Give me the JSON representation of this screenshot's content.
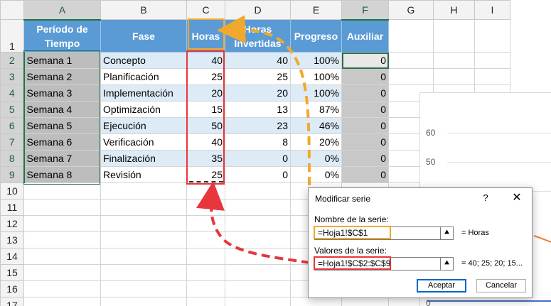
{
  "columns": [
    "A",
    "B",
    "C",
    "D",
    "E",
    "F",
    "G",
    "H",
    "I"
  ],
  "row_numbers": [
    "1",
    "2",
    "3",
    "4",
    "5",
    "6",
    "7",
    "8",
    "9",
    "10",
    "11",
    "12",
    "13",
    "14",
    "15",
    "16",
    "17"
  ],
  "headers": {
    "periodo": "Período de Tiempo",
    "fase": "Fase",
    "horas": "Horas",
    "invertidas": "Horas Invertidas",
    "progreso": "Progreso",
    "auxiliar": "Auxiliar"
  },
  "rows": [
    {
      "periodo": "Semana 1",
      "fase": "Concepto",
      "horas": "40",
      "invertidas": "40",
      "progreso": "100%",
      "auxiliar": "0"
    },
    {
      "periodo": "Semana 2",
      "fase": "Planificación",
      "horas": "25",
      "invertidas": "25",
      "progreso": "100%",
      "auxiliar": "0"
    },
    {
      "periodo": "Semana 3",
      "fase": "Implementación",
      "horas": "20",
      "invertidas": "20",
      "progreso": "100%",
      "auxiliar": "0"
    },
    {
      "periodo": "Semana 4",
      "fase": "Optimización",
      "horas": "15",
      "invertidas": "13",
      "progreso": "87%",
      "auxiliar": "0"
    },
    {
      "periodo": "Semana 5",
      "fase": "Ejecución",
      "horas": "50",
      "invertidas": "23",
      "progreso": "46%",
      "auxiliar": "0"
    },
    {
      "periodo": "Semana 6",
      "fase": "Verificación",
      "horas": "40",
      "invertidas": "8",
      "progreso": "20%",
      "auxiliar": "0"
    },
    {
      "periodo": "Semana 7",
      "fase": "Finalización",
      "horas": "35",
      "invertidas": "0",
      "progreso": "0%",
      "auxiliar": "0"
    },
    {
      "periodo": "Semana 8",
      "fase": "Revisión",
      "horas": "25",
      "invertidas": "0",
      "progreso": "0%",
      "auxiliar": "0"
    }
  ],
  "chart": {
    "ytick_60": "60",
    "ytick_50": "50",
    "ytick_0": "0"
  },
  "dialog": {
    "title": "Modificar serie",
    "help": "?",
    "close": "✕",
    "name_label": "Nombre de la serie:",
    "name_value": "=Hoja1!$C$1",
    "name_preview": "= Horas",
    "values_label": "Valores de la serie:",
    "values_value": "=Hoja1!$C$2:$C$9",
    "values_preview": "= 40; 25; 20; 15...",
    "accept": "Aceptar",
    "cancel": "Cancelar"
  },
  "colors": {
    "header_blue": "#5b9bd5",
    "band_blue": "#ddebf7",
    "highlight_orange": "#f0a92c",
    "highlight_red": "#e8363d",
    "excel_green": "#217346"
  }
}
